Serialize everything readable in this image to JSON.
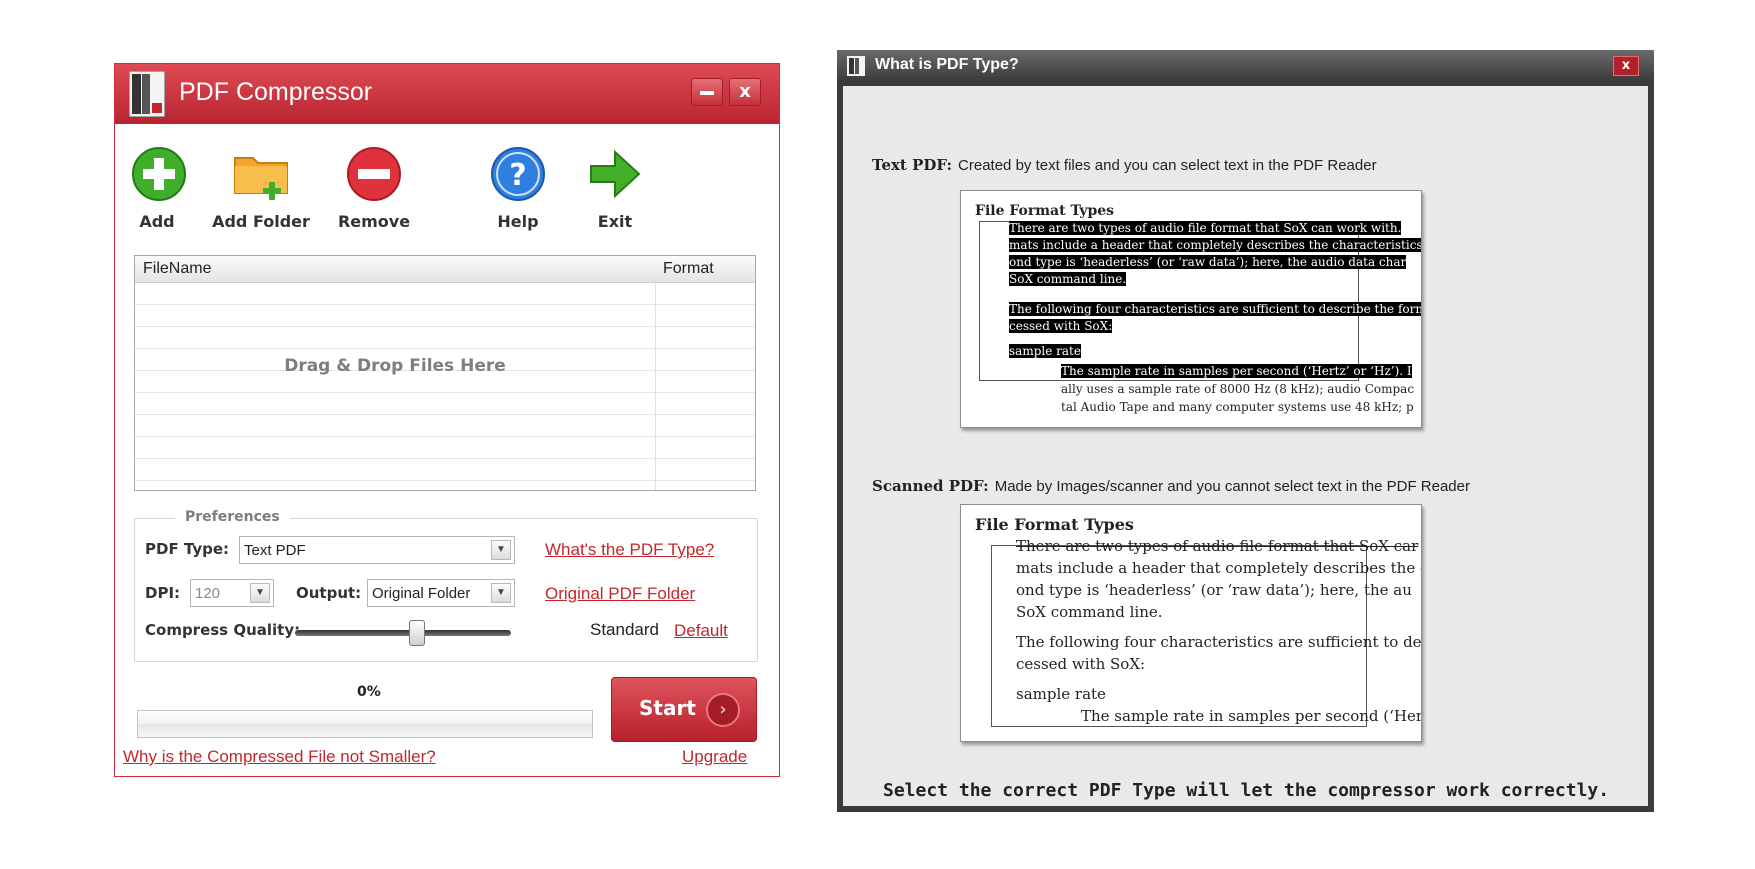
{
  "app": {
    "title": "PDF Compressor",
    "accent_color": "#c1272d",
    "window_buttons": {
      "minimize_icon": "minimize-icon",
      "close_label": "x"
    }
  },
  "toolbar": [
    {
      "label": "Add",
      "icon": "plus-circle-icon"
    },
    {
      "label": "Add Folder",
      "icon": "add-folder-icon"
    },
    {
      "label": "Remove",
      "icon": "minus-circle-icon"
    },
    {
      "label": "Help",
      "icon": "help-icon"
    },
    {
      "label": "Exit",
      "icon": "arrow-right-icon"
    }
  ],
  "filelist": {
    "columns": [
      "FileName",
      "Format"
    ],
    "placeholder": "Drag & Drop Files Here"
  },
  "preferences": {
    "legend": "Preferences",
    "pdf_type_label": "PDF Type:",
    "pdf_type_value": "Text PDF",
    "pdf_type_link": "What's the PDF Type?",
    "dpi_label": "DPI:",
    "dpi_value": "120",
    "output_label": "Output:",
    "output_value": "Original Folder",
    "output_link": "Original PDF Folder",
    "quality_label": "Compress Quality:",
    "quality_value": "Standard",
    "quality_default_link": "Default",
    "quality_level": 0.5
  },
  "progress": {
    "percent_text": "0%",
    "value": 0
  },
  "start_label": "Start",
  "links": {
    "why_not_smaller": "Why is the Compressed File not Smaller?",
    "upgrade": "Upgrade"
  },
  "dialog": {
    "title": "What is PDF Type?",
    "close_label": "x",
    "text_pdf": {
      "term": "Text PDF:",
      "desc": "Created by text files and you can select text in the PDF Reader"
    },
    "scanned_pdf": {
      "term": "Scanned PDF:",
      "desc": "Made by Images/scanner and you cannot select text in the PDF Reader"
    },
    "sample1": {
      "heading": "File Format Types",
      "lines": [
        "There are two types of audio file format that SoX can work with.",
        "mats include a header that completely describes the characteristics",
        "ond type is ‘headerless’ (or ‘raw data’); here, the audio data char",
        "SoX command line.",
        "The following four characteristics are sufficient to describe the form",
        "cessed with SoX:",
        "sample rate",
        "The sample rate in samples per second (‘Hertz’ or ‘Hz’). I",
        "ally uses a sample rate of 8000 Hz (8 kHz); audio Compac",
        "tal Audio Tape and many computer systems use 48 kHz; p"
      ]
    },
    "sample2": {
      "heading": "File Format Types",
      "lines": [
        "There are two types of audio file format that SoX car",
        "mats include a header that completely describes the ch",
        "ond type is ‘headerless’ (or ‘raw data’); here, the au",
        "SoX command line.",
        "The following four characteristics are sufficient to desc",
        "cessed with SoX:",
        "sample rate",
        "The sample rate in samples per second (‘Hert"
      ]
    },
    "note": "Select the correct PDF Type will let the compressor work correctly."
  }
}
